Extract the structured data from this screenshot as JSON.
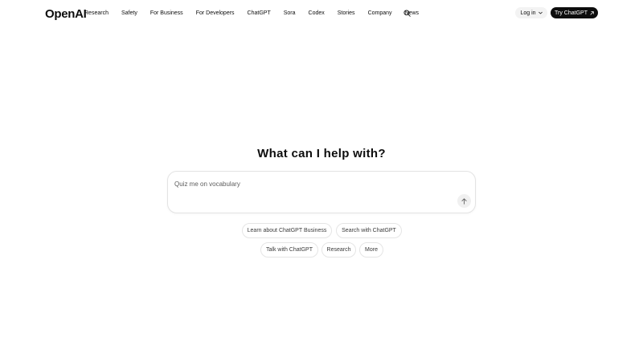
{
  "header": {
    "logo": "OpenAI",
    "nav": [
      "Research",
      "Safety",
      "For Business",
      "For Developers",
      "ChatGPT",
      "Sora",
      "Codex",
      "Stories",
      "Company",
      "News"
    ],
    "search_icon": "search-icon",
    "login_label": "Log in",
    "login_icon": "chevron-down-icon",
    "cta_label": "Try ChatGPT",
    "cta_icon": "arrow-up-right-icon"
  },
  "hero": {
    "title": "What can I help with?"
  },
  "prompt": {
    "placeholder": "Quiz me on vocabulary",
    "value": "",
    "send_icon": "arrow-up-icon"
  },
  "suggestions": [
    "Learn about ChatGPT Business",
    "Search with ChatGPT",
    "Talk with ChatGPT",
    "Research",
    "More"
  ],
  "colors": {
    "text": "#0d0d0d",
    "cta_background": "#0d0d0d",
    "login_background": "#f3f3f3",
    "border": "#e3e3e3"
  }
}
